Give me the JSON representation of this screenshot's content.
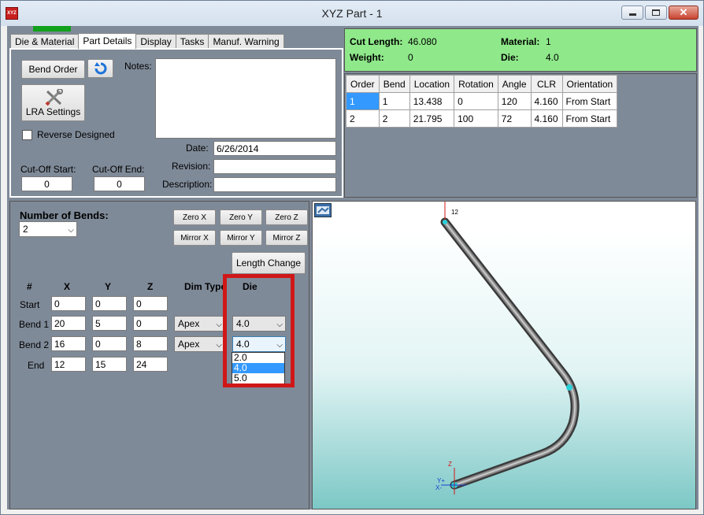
{
  "window": {
    "title": "XYZ Part - 1",
    "app_icon": "XYZ"
  },
  "tabs": [
    {
      "label": "Die & Material",
      "active": false
    },
    {
      "label": "Part Details",
      "active": true
    },
    {
      "label": "Display",
      "active": false
    },
    {
      "label": "Tasks",
      "active": false
    },
    {
      "label": "Manuf. Warning",
      "active": false
    }
  ],
  "part_details": {
    "bend_order_button": "Bend Order",
    "lra_settings_button": "LRA Settings",
    "notes_label": "Notes:",
    "notes_value": "",
    "reverse_designed_label": "Reverse Designed",
    "reverse_designed_checked": false,
    "date_label": "Date:",
    "date_value": "6/26/2014",
    "revision_label": "Revision:",
    "revision_value": "",
    "description_label": "Description:",
    "description_value": "",
    "cutoff_start_label": "Cut-Off Start:",
    "cutoff_start_value": "0",
    "cutoff_end_label": "Cut-Off End:",
    "cutoff_end_value": "0"
  },
  "summary": {
    "cut_length_label": "Cut Length:",
    "cut_length_value": "46.080",
    "weight_label": "Weight:",
    "weight_value": "0",
    "material_label": "Material:",
    "material_value": "1",
    "die_label": "Die:",
    "die_value": "4.0",
    "bg_color": "#8fe98a"
  },
  "bend_table": {
    "columns": [
      "Order",
      "Bend",
      "Location",
      "Rotation",
      "Angle",
      "CLR",
      "Orientation"
    ],
    "rows": [
      [
        "1",
        "1",
        "13.438",
        "0",
        "120",
        "4.160",
        "From Start"
      ],
      [
        "2",
        "2",
        "21.795",
        "100",
        "72",
        "4.160",
        "From Start"
      ]
    ]
  },
  "bends_panel": {
    "number_of_bends_label": "Number of Bends:",
    "number_of_bends_value": "2",
    "zero_x": "Zero X",
    "zero_y": "Zero Y",
    "zero_z": "Zero Z",
    "mirror_x": "Mirror X",
    "mirror_y": "Mirror Y",
    "mirror_z": "Mirror Z",
    "length_change": "Length Change",
    "headers": {
      "num": "#",
      "x": "X",
      "y": "Y",
      "z": "Z",
      "dim_type": "Dim Type",
      "die": "Die"
    },
    "rows": [
      {
        "label": "Start",
        "x": "0",
        "y": "0",
        "z": "0"
      },
      {
        "label": "Bend 1",
        "x": "20",
        "y": "5",
        "z": "0",
        "dim_type": "Apex",
        "die": "4.0"
      },
      {
        "label": "Bend 2",
        "x": "16",
        "y": "0",
        "z": "8",
        "dim_type": "Apex",
        "die": "4.0"
      },
      {
        "label": "End",
        "x": "12",
        "y": "15",
        "z": "24"
      }
    ],
    "die_dropdown_options": [
      "2.0",
      "4.0",
      "5.0"
    ],
    "die_dropdown_selected": "4.0",
    "highlight_color": "#d01717"
  },
  "viewer": {
    "top_label": "12",
    "axis_labels": {
      "z": "Z",
      "y": "Y+",
      "x": "X-"
    }
  }
}
